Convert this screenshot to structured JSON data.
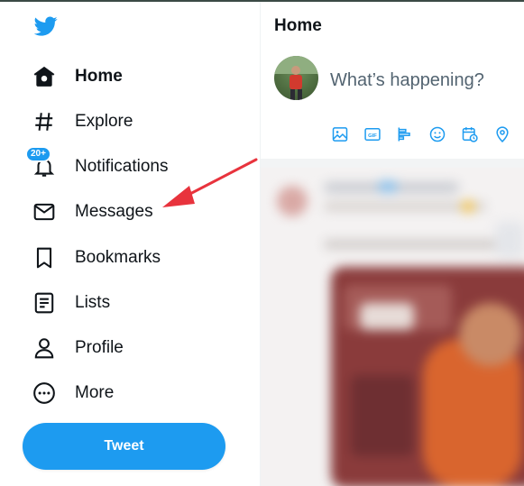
{
  "sidebar": {
    "items": [
      {
        "label": "Home",
        "icon": "home-icon",
        "active": true
      },
      {
        "label": "Explore",
        "icon": "hashtag-icon",
        "active": false
      },
      {
        "label": "Notifications",
        "icon": "bell-icon",
        "active": false,
        "badge": "20+"
      },
      {
        "label": "Messages",
        "icon": "envelope-icon",
        "active": false
      },
      {
        "label": "Bookmarks",
        "icon": "bookmark-icon",
        "active": false
      },
      {
        "label": "Lists",
        "icon": "list-icon",
        "active": false
      },
      {
        "label": "Profile",
        "icon": "person-icon",
        "active": false
      },
      {
        "label": "More",
        "icon": "more-circle-icon",
        "active": false
      }
    ],
    "tweet_button": "Tweet"
  },
  "main": {
    "title": "Home",
    "compose": {
      "placeholder": "What’s happening?",
      "tools": [
        "image-icon",
        "gif-icon",
        "poll-icon",
        "emoji-icon",
        "schedule-icon",
        "location-icon"
      ],
      "gif_label": "GIF"
    }
  },
  "colors": {
    "brand_blue": "#1d9bf0",
    "text": "#0f1419",
    "muted": "#536471",
    "annotation_arrow": "#e8333d"
  }
}
